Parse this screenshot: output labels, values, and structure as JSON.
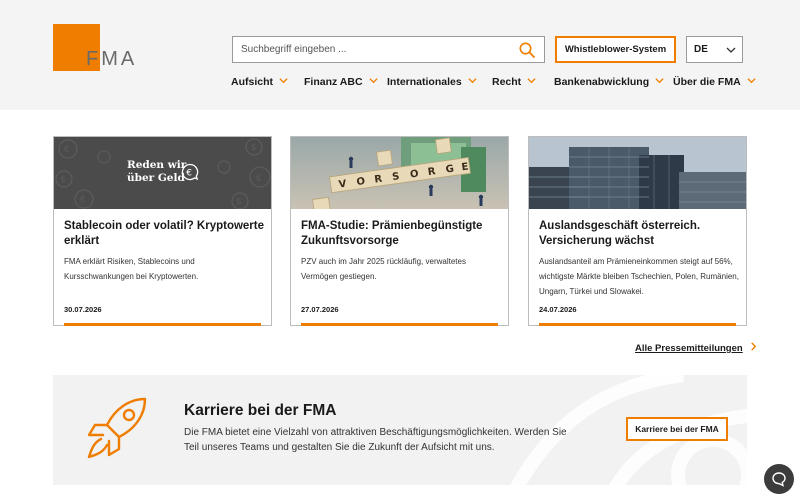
{
  "brand": {
    "logo_text": "FMA",
    "accent": "#ef7d00"
  },
  "search": {
    "placeholder": "Suchbegriff eingeben ..."
  },
  "header": {
    "whistleblower_label": "Whistleblower-System",
    "language": "DE"
  },
  "nav": {
    "items": [
      {
        "label": "Aufsicht"
      },
      {
        "label": "Finanz ABC"
      },
      {
        "label": "Internationales"
      },
      {
        "label": "Recht"
      },
      {
        "label": "Bankenabwicklung"
      },
      {
        "label": "Über die FMA"
      }
    ]
  },
  "cards": [
    {
      "image_caption": "Reden wir\nüber Geld",
      "title": "Stablecoin oder volatil? Kryptowerte erklärt",
      "text": "FMA erklärt Risiken, Stablecoins und Kursschwankungen bei Kryptowerten.",
      "date": "30.07.2026"
    },
    {
      "image_caption": "VORSORGE",
      "title": "FMA-Studie: Prämienbegünstigte Zukunftsvorsorge",
      "text": "PZV auch im Jahr 2025 rückläufig, verwaltetes Vermögen gestiegen.",
      "date": "27.07.2026"
    },
    {
      "title": "Auslandsgeschäft österreich. Versicherung wächst",
      "text": "Auslandsanteil am Prämieneinkommen steigt auf 56%, wichtigste Märkte bleiben Tschechien, Polen, Rumänien, Ungarn, Türkei und Slowakei.",
      "date": "24.07.2026"
    }
  ],
  "press": {
    "all_link": "Alle Pressemitteilungen"
  },
  "career": {
    "title": "Karriere bei der FMA",
    "text": "Die FMA bietet eine Vielzahl von attraktiven Beschäftigungsmöglichkeiten. Werden Sie Teil unseres Teams und gestalten Sie die Zukunft der Aufsicht mit uns.",
    "button_label": "Karriere bei der FMA"
  },
  "icons": [
    "search-icon",
    "chevron-down-icon",
    "chevron-right-icon",
    "rocket-icon",
    "chat-icon"
  ]
}
